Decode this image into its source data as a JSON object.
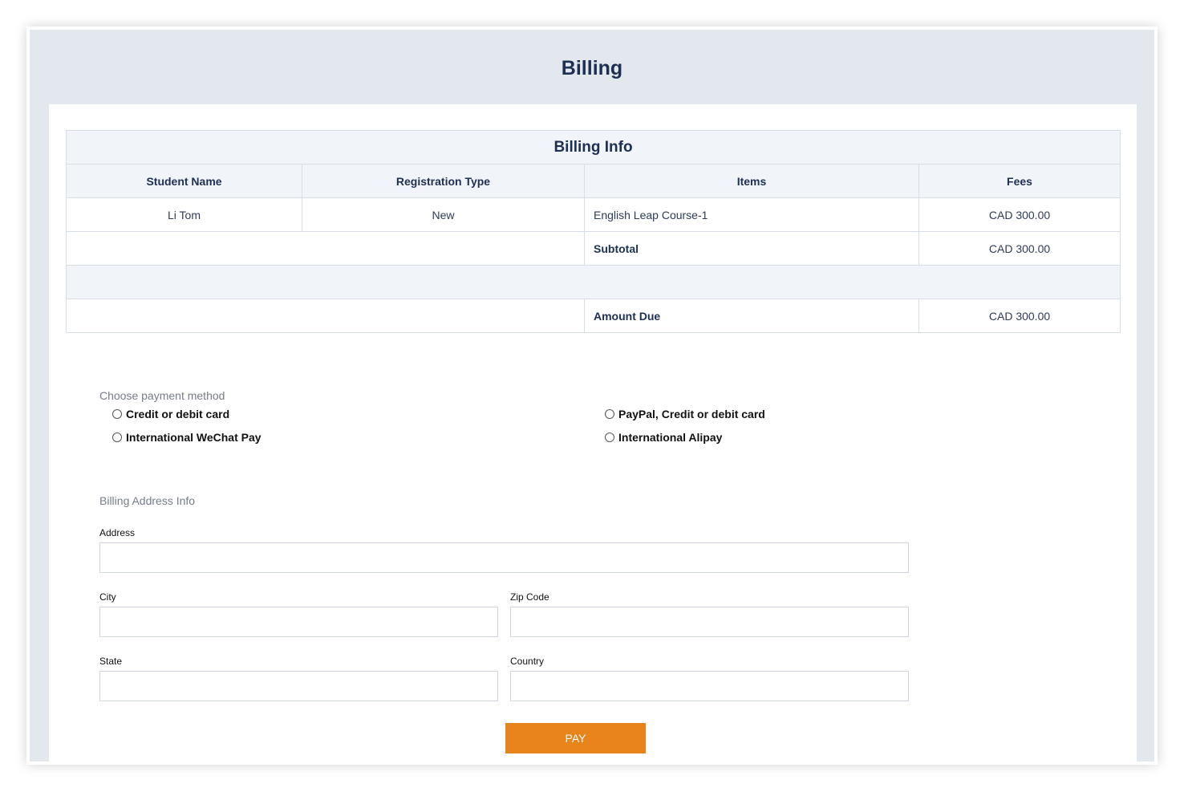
{
  "page": {
    "title": "Billing"
  },
  "billing_table": {
    "title": "Billing Info",
    "headers": [
      "Student Name",
      "Registration Type",
      "Items",
      "Fees"
    ],
    "row": {
      "student_name": "Li Tom",
      "registration_type": "New",
      "item": "English Leap Course-1",
      "fee": "CAD 300.00"
    },
    "subtotal_label": "Subtotal",
    "subtotal_value": "CAD 300.00",
    "amount_due_label": "Amount Due",
    "amount_due_value": "CAD 300.00"
  },
  "payment": {
    "label": "Choose payment method",
    "options": [
      "Credit or debit card",
      "PayPal, Credit or debit card",
      "International WeChat Pay",
      "International Alipay"
    ]
  },
  "address": {
    "section_label": "Billing Address Info",
    "address_label": "Address",
    "city_label": "City",
    "zip_label": "Zip Code",
    "state_label": "State",
    "country_label": "Country"
  },
  "pay_button": {
    "label": "PAY"
  }
}
